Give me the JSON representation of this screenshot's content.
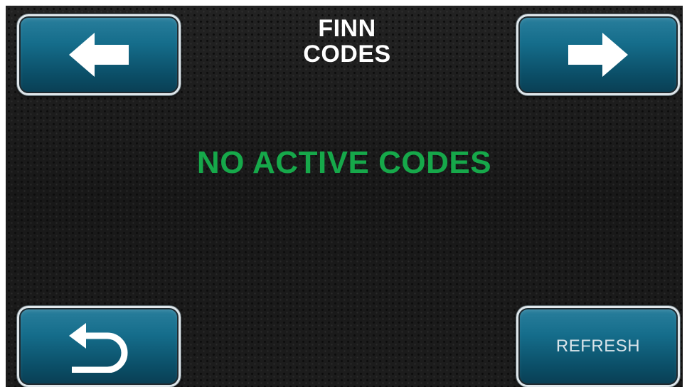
{
  "header": {
    "title_line1": "FINN",
    "title_line2": "CODES"
  },
  "main": {
    "status_text": "NO ACTIVE CODES",
    "status_color": "#16a84a"
  },
  "buttons": {
    "back_icon": "arrow-left-icon",
    "forward_icon": "arrow-right-icon",
    "return_icon": "return-arrow-icon",
    "refresh_label": "REFRESH"
  },
  "colors": {
    "button_fill": "#156d8b",
    "button_border": "#dfe6ea",
    "background": "#1a1a1a"
  }
}
